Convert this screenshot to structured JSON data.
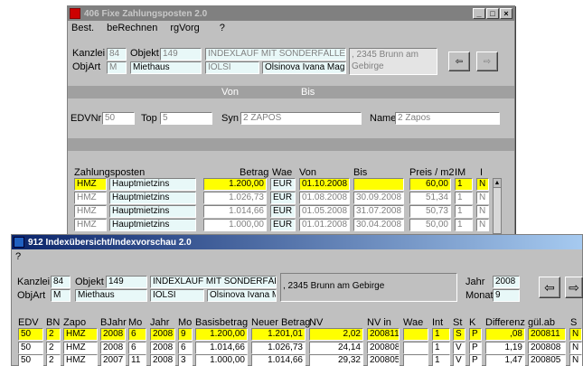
{
  "window406": {
    "title": "406 Fixe Zahlungsposten 2.0",
    "menu": [
      "Best.",
      "beRechnen",
      "rgVorg",
      "?"
    ],
    "kanzlei_label": "Kanzlei",
    "kanzlei": "84",
    "objekt_label": "Objekt",
    "objekt": "149",
    "objekt_name": "INDEXLAUF MIT SONDERFÄLLEN",
    "address": ", 2345 Brunn am Gebirge",
    "objart_label": "ObjArt",
    "objart": "M",
    "objart_name": "Miethaus",
    "owner_code": "IOLSI",
    "owner_name": "Olsinova Ivana Mag.",
    "von_label": "Von",
    "bis_label": "Bis",
    "edvnr_label": "EDVNr",
    "edvnr": "50",
    "top_label": "Top",
    "top": "5",
    "syn_label": "Syn",
    "syn": "2 ZAPOS",
    "name_label": "Name",
    "name": "2 Zapos",
    "headers": [
      "Zahlungsposten",
      "Betrag",
      "Wae",
      "Von",
      "Bis",
      "Preis / m2",
      "IM",
      "I"
    ],
    "rows": [
      {
        "code": "HMZ",
        "label": "Hauptmietzins",
        "betrag": "1.200,00",
        "wae": "EUR",
        "von": "01.10.2008",
        "bis": "",
        "preis": "60,00",
        "im": "1",
        "i": "N"
      },
      {
        "code": "HMZ",
        "label": "Hauptmietzins",
        "betrag": "1.026,73",
        "wae": "EUR",
        "von": "01.08.2008",
        "bis": "30.09.2008",
        "preis": "51,34",
        "im": "1",
        "i": "N"
      },
      {
        "code": "HMZ",
        "label": "Hauptmietzins",
        "betrag": "1.014,66",
        "wae": "EUR",
        "von": "01.05.2008",
        "bis": "31.07.2008",
        "preis": "50,73",
        "im": "1",
        "i": "N"
      },
      {
        "code": "HMZ",
        "label": "Hauptmietzins",
        "betrag": "1.000,00",
        "wae": "EUR",
        "von": "01.01.2008",
        "bis": "30.04.2008",
        "preis": "50,00",
        "im": "1",
        "i": "N"
      }
    ]
  },
  "window912": {
    "title": "912 Indexübersicht/Indexvorschau 2.0",
    "menu": [
      "?"
    ],
    "kanzlei_label": "Kanzlei",
    "kanzlei": "84",
    "objekt_label": "Objekt",
    "objekt": "149",
    "objekt_name": "INDEXLAUF MIT SONDERFÄLLE",
    "address": ", 2345 Brunn am Gebirge",
    "objart_label": "ObjArt",
    "objart": "M",
    "objart_name": "Miethaus",
    "owner_code": "IOLSI",
    "owner_name": "Olsinova Ivana Ma",
    "jahr_label": "Jahr",
    "jahr": "2008",
    "monat_label": "Monat",
    "monat": "9",
    "headers": [
      "EDV",
      "BN",
      "Zapo",
      "BJahr",
      "Mo",
      "Jahr",
      "Mo",
      "Basisbetrag",
      "Neuer Betrag",
      "NV",
      "NV in",
      "Wae",
      "Int",
      "St",
      "K",
      "Differenz",
      "gül.ab",
      "S"
    ],
    "rows": [
      {
        "edv": "50",
        "bn": "2",
        "zapo": "HMZ",
        "bjahr": "2008",
        "mo": "6",
        "jahr": "2008",
        "mo2": "9",
        "basis": "1.200,00",
        "neu": "1.201,01",
        "nv": "2,02",
        "nvin": "200811",
        "wae": "",
        "int": "1",
        "st": "S",
        "k": "P",
        "diff": ",08",
        "gulab": "200811",
        "s": "N"
      },
      {
        "edv": "50",
        "bn": "2",
        "zapo": "HMZ",
        "bjahr": "2008",
        "mo": "6",
        "jahr": "2008",
        "mo2": "6",
        "basis": "1.014,66",
        "neu": "1.026,73",
        "nv": "24,14",
        "nvin": "200808",
        "wae": "",
        "int": "1",
        "st": "V",
        "k": "P",
        "diff": "1,19",
        "gulab": "200808",
        "s": "N"
      },
      {
        "edv": "50",
        "bn": "2",
        "zapo": "HMZ",
        "bjahr": "2007",
        "mo": "11",
        "jahr": "2008",
        "mo2": "3",
        "basis": "1.000,00",
        "neu": "1.014,66",
        "nv": "29,32",
        "nvin": "200805",
        "wae": "",
        "int": "1",
        "st": "V",
        "k": "P",
        "diff": "1,47",
        "gulab": "200805",
        "s": "N"
      }
    ]
  },
  "colors": {
    "yellow": "#ffff00",
    "cyan": "#e8f8f8",
    "titlebar_active": "#0a246a",
    "titlebar_inactive": "#808080"
  }
}
